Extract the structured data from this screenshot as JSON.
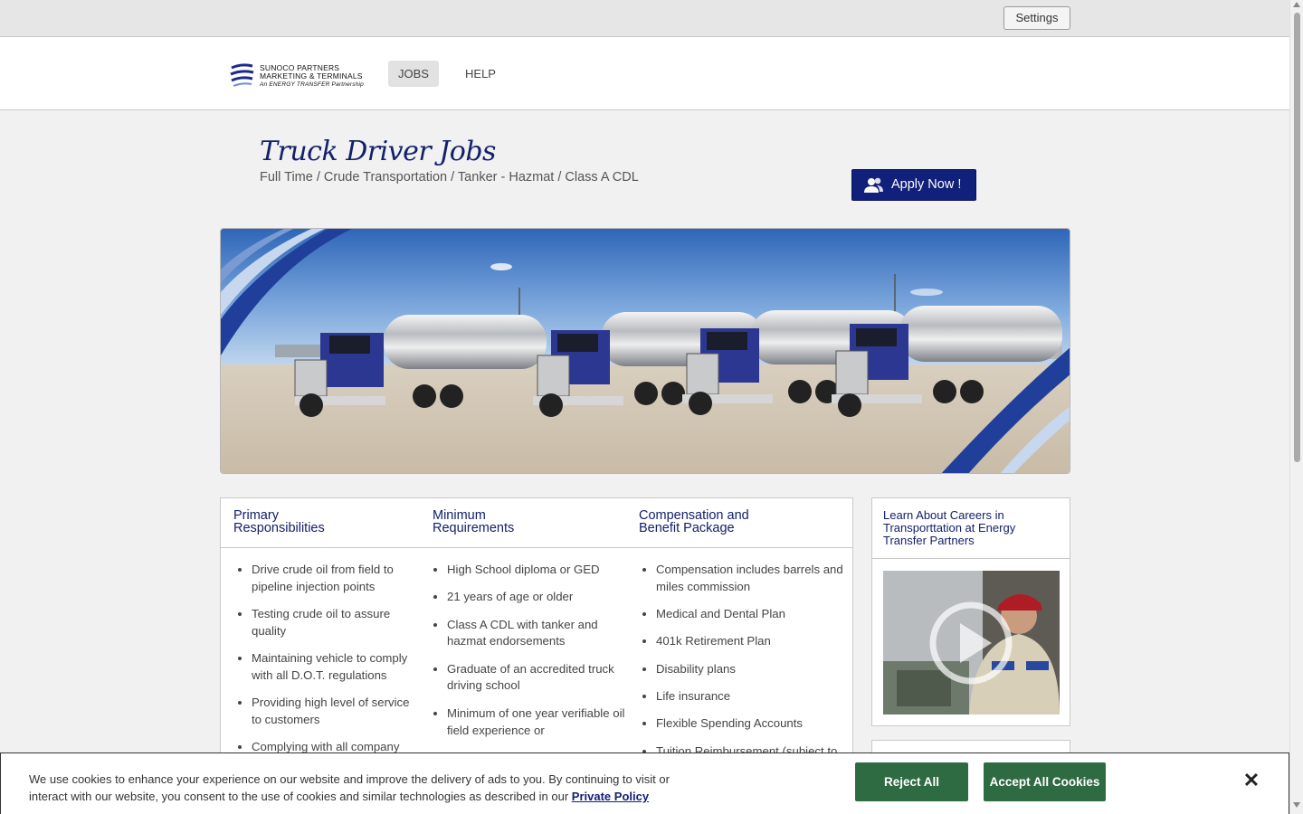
{
  "topbar": {
    "settings_label": "Settings"
  },
  "brand": {
    "line1": "SUNOCO PARTNERS",
    "line2": "MARKETING & TERMINALS",
    "line3": "An ENERGY TRANSFER Partnership"
  },
  "nav": {
    "jobs_label": "JOBS",
    "help_label": "HELP"
  },
  "header": {
    "title": "Truck Driver Jobs",
    "subtitle": "Full Time / Crude Transportation / Tanker - Hazmat / Class A CDL",
    "apply_label": "Apply Now !"
  },
  "columns": [
    {
      "title_l1": "Primary",
      "title_l2": "Responsibilities",
      "items": [
        "Drive crude oil from field to pipeline injection points",
        "Testing crude oil to assure quality",
        "Maintaining vehicle to comply with all D.O.T. regulations",
        "Providing high level of service to customers",
        "Complying with all company"
      ]
    },
    {
      "title_l1": "Minimum",
      "title_l2": "Requirements",
      "items": [
        "High School diploma or GED",
        "21 years of age or older",
        "Class A CDL with tanker and hazmat endorsements",
        "Graduate of an accredited truck driving school",
        "Minimum of one year verifiable oil field experience or"
      ]
    },
    {
      "title_l1": "Compensation and",
      "title_l2": "Benefit Package",
      "items": [
        "Compensation includes barrels and miles commission",
        "Medical and Dental Plan",
        "401k Retirement Plan",
        "Disability plans",
        "Life insurance",
        "Flexible Spending Accounts",
        "Tuition Reimbursement (subject to"
      ]
    }
  ],
  "side": {
    "title": "Learn About Careers in Transporttation at Energy Transfer Partners"
  },
  "cookie": {
    "text": "We use cookies to enhance your experience on our website and improve the delivery of ads to you. By continuing to visit or interact with our website, you consent to the use of cookies and similar technologies as described in our",
    "link_label": "Private Policy",
    "reject_label": "Reject All",
    "accept_label": "Accept All Cookies",
    "close_label": "✕"
  },
  "colors": {
    "brand_navy": "#11207a",
    "cookie_green": "#2f6b42"
  }
}
